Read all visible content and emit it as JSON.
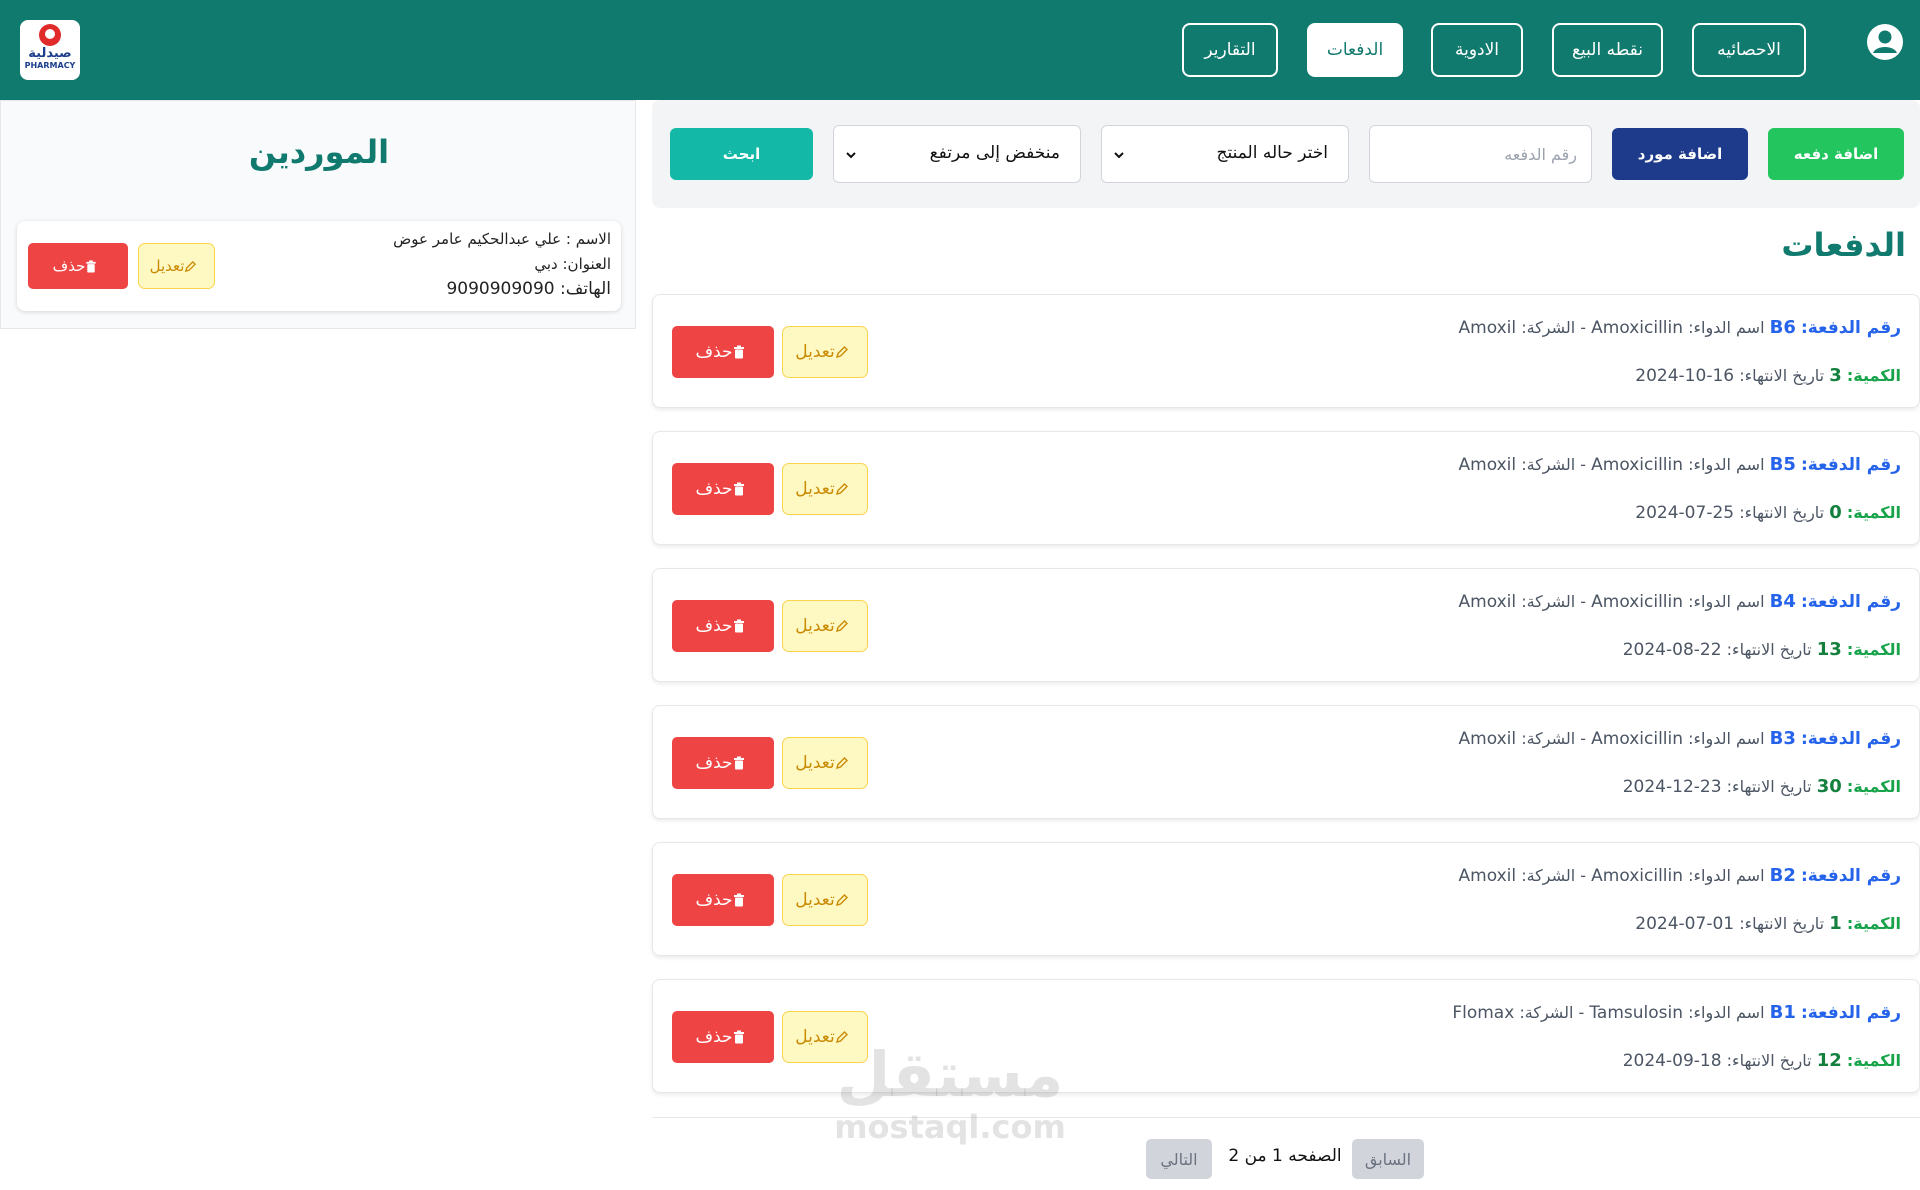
{
  "header": {
    "logo_text_ar": "صيدلية",
    "logo_text_en": "PHARMACY",
    "nav": [
      {
        "label": "الاحصائيه",
        "active": false
      },
      {
        "label": "نقطه البيع",
        "active": false
      },
      {
        "label": "الادوية",
        "active": false
      },
      {
        "label": "الدفعات",
        "active": true
      },
      {
        "label": "التقارير",
        "active": false
      }
    ],
    "user_icon": "user-circle-icon",
    "colors": {
      "primary": "#117a6e"
    }
  },
  "suppliers": {
    "title": "الموردين",
    "items": [
      {
        "name_line": "الاسم : علي عبدالحكيم عامر عوض",
        "address_line": "العنوان: دبي",
        "phone_line": "الهاتف: 9090909090",
        "edit_label": "تعديل",
        "delete_label": "حذف"
      }
    ]
  },
  "toolbar": {
    "add_batch_label": "اضافة دفعه",
    "add_supplier_label": "اضافة مورد",
    "batch_number_placeholder": "رقم الدفعه",
    "status_select_value": "اختر حاله المنتج",
    "sort_select_value": "منخفض إلى مرتفع",
    "search_label": "ابحث",
    "colors": {
      "add_batch": "#22c55e",
      "add_supplier": "#1e3a8a",
      "search": "#14b8a6"
    }
  },
  "batches": {
    "title": "الدفعات",
    "labels": {
      "batch_no": "رقم الدفعة:",
      "drug_name": "اسم الدواء:",
      "company": "الشركة:",
      "quantity": "الكمية:",
      "expiry": "تاريخ الانتهاء:",
      "edit": "تعديل",
      "delete": "حذف"
    },
    "items": [
      {
        "id": "B6",
        "drug": "Amoxicillin",
        "company": "Amoxil",
        "quantity": "3",
        "expiry": "16-10-2024"
      },
      {
        "id": "B5",
        "drug": "Amoxicillin",
        "company": "Amoxil",
        "quantity": "0",
        "expiry": "25-07-2024"
      },
      {
        "id": "B4",
        "drug": "Amoxicillin",
        "company": "Amoxil",
        "quantity": "13",
        "expiry": "22-08-2024"
      },
      {
        "id": "B3",
        "drug": "Amoxicillin",
        "company": "Amoxil",
        "quantity": "30",
        "expiry": "23-12-2024"
      },
      {
        "id": "B2",
        "drug": "Amoxicillin",
        "company": "Amoxil",
        "quantity": "1",
        "expiry": "01-07-2024"
      },
      {
        "id": "B1",
        "drug": "Tamsulosin",
        "company": "Flomax",
        "quantity": "12",
        "expiry": "18-09-2024"
      }
    ]
  },
  "pagination": {
    "prev_label": "السابق",
    "page_info": "الصفحه 1 من 2",
    "next_label": "التالي"
  },
  "watermark": {
    "ar": "مستقل",
    "en": "mostaql.com"
  }
}
